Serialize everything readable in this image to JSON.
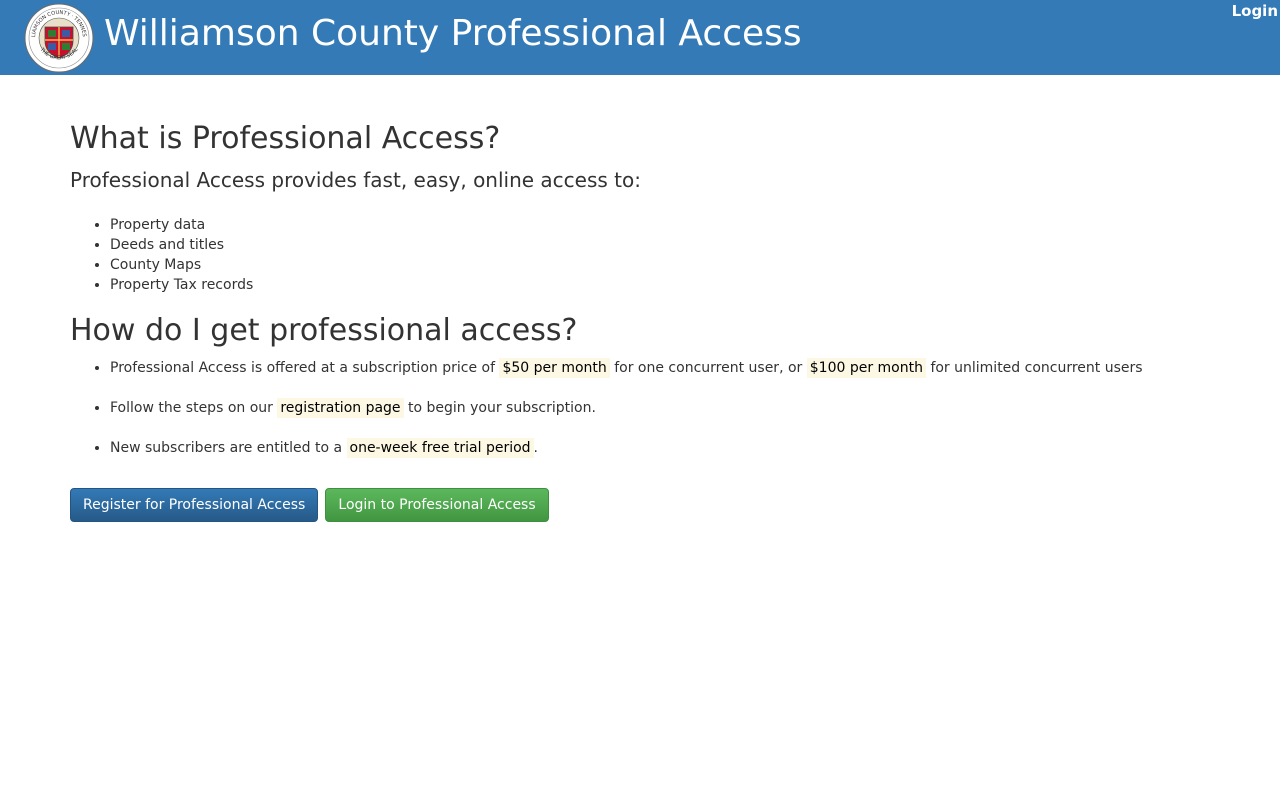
{
  "header": {
    "title": "Williamson County Professional Access",
    "login_label": "Login",
    "seal_text_top": "WILLIAMSON COUNTY · TENNESSEE",
    "seal_text_bottom": "THE GREAT SEAL"
  },
  "main": {
    "what_heading": "What is Professional Access?",
    "lead": "Professional Access provides fast, easy, online access to:",
    "features": [
      "Property data",
      "Deeds and titles",
      "County Maps",
      "Property Tax records"
    ],
    "how_heading": "How do I get professional access?",
    "steps": {
      "price": {
        "prefix": "Professional Access is offered at a subscription price of",
        "single_price": "$50 per month",
        "middle": "for one concurrent user, or",
        "unlimited_price": "$100 per month",
        "suffix": "for unlimited concurrent users"
      },
      "register": {
        "prefix": "Follow the steps on our",
        "link": "registration page",
        "suffix": "to begin your subscription."
      },
      "trial": {
        "prefix": "New subscribers are entitled to a",
        "highlight": "one-week free trial period",
        "suffix": "."
      }
    },
    "buttons": {
      "register": "Register for Professional Access",
      "login": "Login to Professional Access"
    }
  },
  "colors": {
    "header_bg": "#337ab7",
    "primary": "#337ab7",
    "success": "#5cb85c",
    "highlight": "#fcf8e3"
  }
}
